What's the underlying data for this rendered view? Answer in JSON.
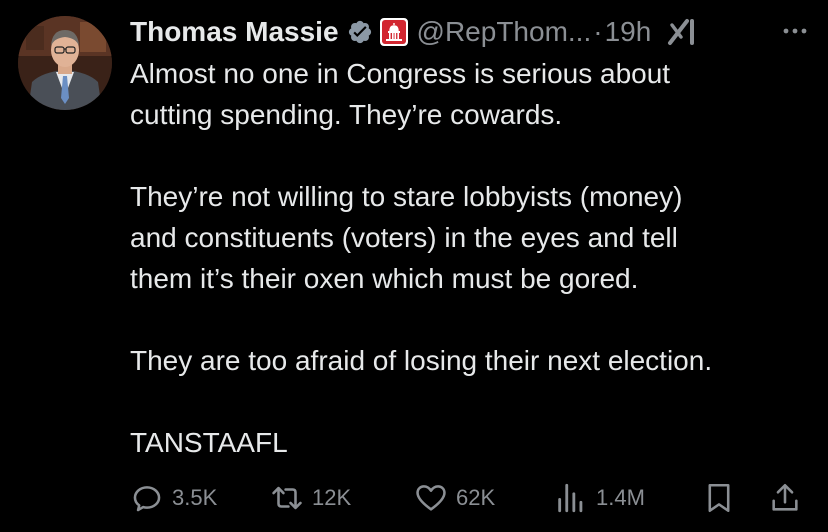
{
  "author": {
    "name": "Thomas Massie",
    "handle": "@RepThom...",
    "separator": "·",
    "time": "19h"
  },
  "badges": {
    "verified_color": "#8b98a5",
    "affiliation_color": "#d22630"
  },
  "tweet": {
    "lines": [
      "Almost no one in Congress is serious about",
      "cutting spending. They’re cowards.",
      "",
      "They’re not willing to stare lobbyists (money)",
      "and constituents (voters) in the eyes and tell",
      "them it’s their oxen which must be gored.",
      "",
      "They are too afraid of losing their next election.",
      "",
      "TANSTAAFL"
    ]
  },
  "actions": {
    "reply_count": "3.5K",
    "retweet_count": "12K",
    "like_count": "62K",
    "views_count": "1.4M"
  },
  "icons": {
    "avatar": "profile-photo",
    "verified": "verified-badge-icon",
    "affiliation": "capitol-badge-icon",
    "grok": "grok-icon",
    "more": "more-icon",
    "reply": "reply-icon",
    "retweet": "retweet-icon",
    "like": "heart-icon",
    "views": "views-icon",
    "bookmark": "bookmark-icon",
    "share": "share-icon"
  }
}
